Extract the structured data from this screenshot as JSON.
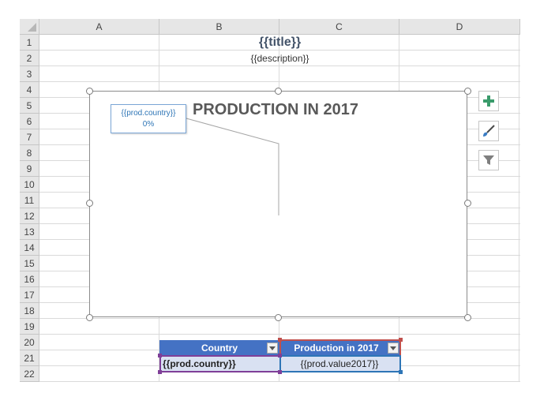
{
  "columns": [
    "A",
    "B",
    "C",
    "D"
  ],
  "rows": [
    "1",
    "2",
    "3",
    "4",
    "5",
    "6",
    "7",
    "8",
    "9",
    "10",
    "11",
    "12",
    "13",
    "14",
    "15",
    "16",
    "17",
    "18",
    "19",
    "20",
    "21",
    "22"
  ],
  "cells": {
    "title": "{{title}}",
    "description": "{{description}}"
  },
  "chart": {
    "title": "PRODUCTION IN 2017",
    "data_label_line1": "{{prod.country}}",
    "data_label_line2": "0%"
  },
  "chart_tools": {
    "add_icon": "plus-icon",
    "style_icon": "brush-icon",
    "filter_icon": "filter-icon"
  },
  "table": {
    "headers": [
      "Country",
      "Production in 2017"
    ],
    "row": [
      "{{prod.country}}",
      "{{prod.value2017}}"
    ],
    "header_color": "#4472c4",
    "row_color": "#d9e1f2"
  },
  "colors": {
    "selection_purple": "#7f3f98",
    "selection_red": "#c0504d",
    "selection_blue": "#2e75b6",
    "title_color": "#44546a"
  }
}
